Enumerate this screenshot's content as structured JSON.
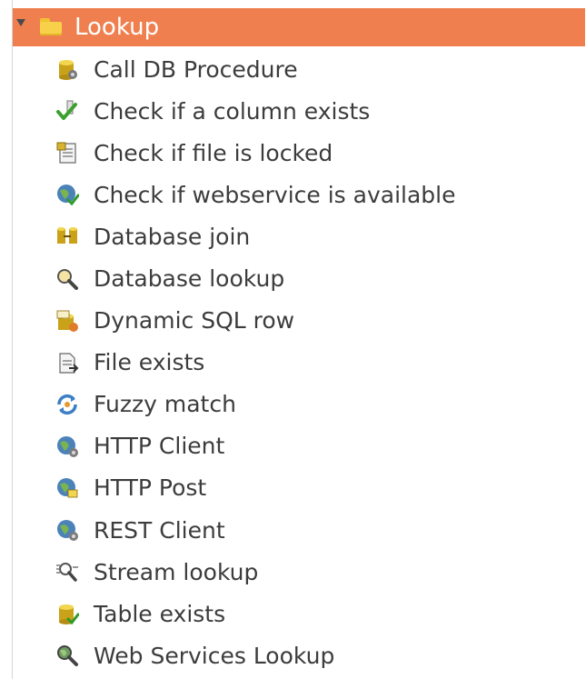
{
  "category": {
    "label": "Lookup",
    "expanded": true,
    "icon": "folder-icon",
    "highlight_color": "#ef7f4f"
  },
  "items": [
    {
      "label": "Call DB Procedure",
      "icon": "database-procedure-icon"
    },
    {
      "label": "Check if a column exists",
      "icon": "check-column-icon"
    },
    {
      "label": "Check if file is locked",
      "icon": "file-locked-icon"
    },
    {
      "label": "Check if webservice is available",
      "icon": "webservice-check-icon"
    },
    {
      "label": "Database join",
      "icon": "database-join-icon"
    },
    {
      "label": "Database lookup",
      "icon": "database-lookup-icon"
    },
    {
      "label": "Dynamic SQL row",
      "icon": "dynamic-sql-icon"
    },
    {
      "label": "File exists",
      "icon": "file-exists-icon"
    },
    {
      "label": "Fuzzy match",
      "icon": "fuzzy-match-icon"
    },
    {
      "label": "HTTP Client",
      "icon": "http-client-icon"
    },
    {
      "label": "HTTP Post",
      "icon": "http-post-icon"
    },
    {
      "label": "REST Client",
      "icon": "rest-client-icon"
    },
    {
      "label": "Stream lookup",
      "icon": "stream-lookup-icon"
    },
    {
      "label": "Table exists",
      "icon": "table-exists-icon"
    },
    {
      "label": "Web Services Lookup",
      "icon": "web-services-lookup-icon"
    }
  ]
}
